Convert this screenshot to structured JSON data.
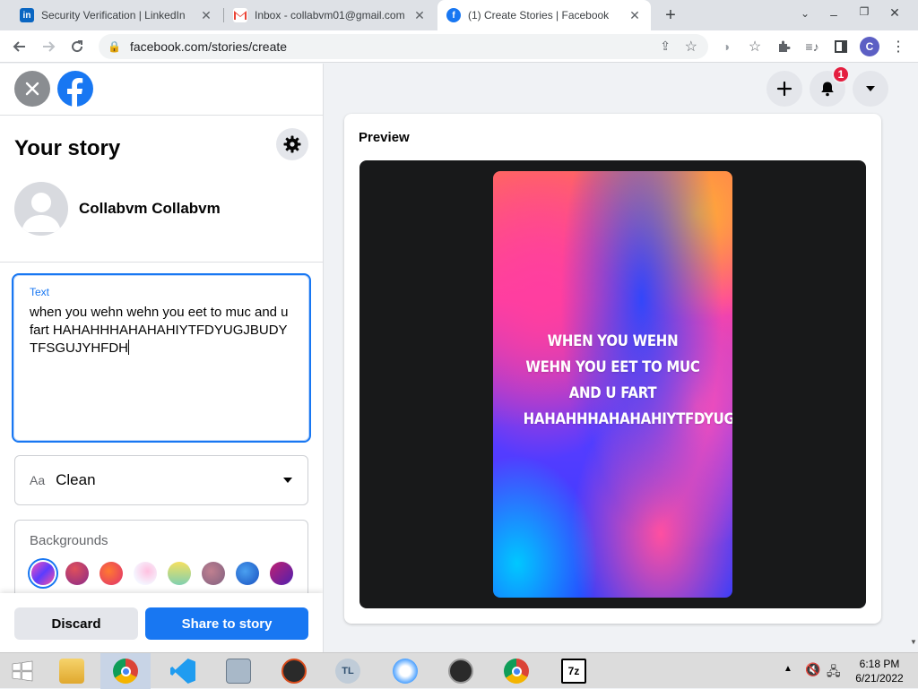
{
  "browser": {
    "tabs": [
      {
        "title": "Security Verification | LinkedIn",
        "favicon": "linkedin-icon",
        "active": false
      },
      {
        "title": "Inbox - collabvm01@gmail.com",
        "favicon": "gmail-icon",
        "active": false
      },
      {
        "title": "(1) Create Stories | Facebook",
        "favicon": "facebook-icon",
        "active": true
      }
    ],
    "url": "facebook.com/stories/create",
    "profile_initial": "C"
  },
  "left_panel": {
    "title": "Your story",
    "user_name": "Collabvm Collabvm",
    "text_label": "Text",
    "text_value": "when you wehn wehn you eet to muc and u fart HAHAHHHAHAHAHIYTFDYUGJBUDYTFSGUJYHFDH",
    "font_prefix": "Aa",
    "font_name": "Clean",
    "backgrounds_label": "Backgrounds",
    "discard_label": "Discard",
    "share_label": "Share to story"
  },
  "header": {
    "notification_count": "1"
  },
  "preview": {
    "label": "Preview",
    "story_text": "WHEN YOU WEHN WEHN YOU EET TO MUC AND U FART HAHAHHHAHAHAHIYTFDYUGJBUDYTFSGUJYHFDH"
  },
  "taskbar": {
    "time": "6:18 PM",
    "date": "6/21/2022"
  },
  "colors": {
    "facebook_blue": "#1877f2",
    "notification_red": "#e41e3f"
  }
}
